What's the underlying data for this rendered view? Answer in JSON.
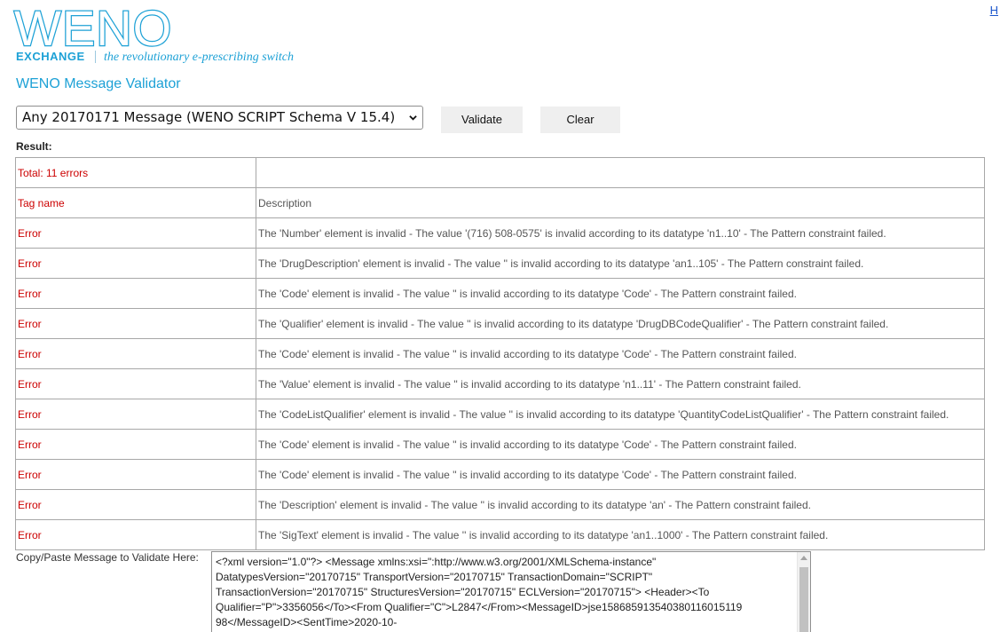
{
  "logo": {
    "word": "WENO",
    "exchange": "EXCHANGE",
    "tagline": "the revolutionary e-prescribing switch"
  },
  "corner_link": "H",
  "page_title": "WENO Message Validator",
  "controls": {
    "schema_selected": "Any 20170171 Message (WENO SCRIPT Schema V 15.4)",
    "validate_label": "Validate",
    "clear_label": "Clear"
  },
  "result_label": "Result:",
  "results": {
    "summary": "Total: 11 errors",
    "summary_desc": "",
    "header_tag": "Tag name",
    "header_desc": "Description",
    "rows": [
      {
        "tag": "Error",
        "desc": "The 'Number' element is invalid - The value '(716) 508-0575' is invalid according to its datatype 'n1..10' - The Pattern constraint failed."
      },
      {
        "tag": "Error",
        "desc": "The 'DrugDescription' element is invalid - The value '' is invalid according to its datatype 'an1..105' - The Pattern constraint failed."
      },
      {
        "tag": "Error",
        "desc": "The 'Code' element is invalid - The value '' is invalid according to its datatype 'Code' - The Pattern constraint failed."
      },
      {
        "tag": "Error",
        "desc": "The 'Qualifier' element is invalid - The value '' is invalid according to its datatype 'DrugDBCodeQualifier' - The Pattern constraint failed."
      },
      {
        "tag": "Error",
        "desc": "The 'Code' element is invalid - The value '' is invalid according to its datatype 'Code' - The Pattern constraint failed."
      },
      {
        "tag": "Error",
        "desc": "The 'Value' element is invalid - The value '' is invalid according to its datatype 'n1..11' - The Pattern constraint failed."
      },
      {
        "tag": "Error",
        "desc": "The 'CodeListQualifier' element is invalid - The value '' is invalid according to its datatype 'QuantityCodeListQualifier' - The Pattern constraint failed."
      },
      {
        "tag": "Error",
        "desc": "The 'Code' element is invalid - The value '' is invalid according to its datatype 'Code' - The Pattern constraint failed."
      },
      {
        "tag": "Error",
        "desc": "The 'Code' element is invalid - The value '' is invalid according to its datatype 'Code' - The Pattern constraint failed."
      },
      {
        "tag": "Error",
        "desc": "The 'Description' element is invalid - The value '' is invalid according to its datatype 'an' - The Pattern constraint failed."
      },
      {
        "tag": "Error",
        "desc": "The 'SigText' element is invalid - The value '' is invalid according to its datatype 'an1..1000' - The Pattern constraint failed."
      }
    ]
  },
  "paste_label": "Copy/Paste Message to Validate Here:",
  "message_text": "<?xml version=\"1.0\"?> <Message xmlns:xsi=\":http://www.w3.org/2001/XMLSchema-instance\" DatatypesVersion=\"20170715\" TransportVersion=\"20170715\" TransactionDomain=\"SCRIPT\" TransactionVersion=\"20170715\" StructuresVersion=\"20170715\" ECLVersion=\"20170715\"> <Header><To Qualifier=\"P\">3356056</To><From Qualifier=\"C\">L2847</From><MessageID>jse158685913540380116015119​98</MessageID><SentTime>2020-10-",
  "colors": {
    "brand_blue": "#1da1d6",
    "error_red": "#cc0000"
  }
}
